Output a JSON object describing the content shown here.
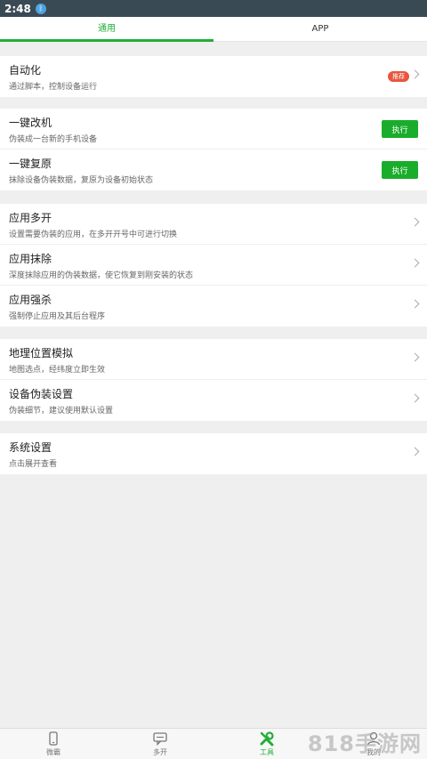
{
  "status": {
    "time": "2:48"
  },
  "tabs": [
    {
      "label": "通用"
    },
    {
      "label": "APP"
    }
  ],
  "rows": {
    "automation": {
      "title": "自动化",
      "sub": "通过脚本，控制设备运行",
      "badge": "推荐"
    },
    "one_key_modify": {
      "title": "一键改机",
      "sub": "伪装成一台新的手机设备",
      "action": "执行"
    },
    "one_key_restore": {
      "title": "一键复原",
      "sub": "抹除设备伪装数据，复原为设备初始状态",
      "action": "执行"
    },
    "app_multi": {
      "title": "应用多开",
      "sub": "设置需要伪装的应用，在多开开号中可进行切换"
    },
    "app_erase": {
      "title": "应用抹除",
      "sub": "深度抹除应用的伪装数据，使它恢复到刚安装的状态"
    },
    "app_kill": {
      "title": "应用强杀",
      "sub": "强制停止应用及其后台程序"
    },
    "geo_mock": {
      "title": "地理位置模拟",
      "sub": "地图选点，经纬度立即生效"
    },
    "device_spoof": {
      "title": "设备伪装设置",
      "sub": "伪装细节，建议使用默认设置"
    },
    "system_settings": {
      "title": "系统设置",
      "sub": "点击展开查看"
    }
  },
  "bottom_nav": [
    {
      "label": "微霸",
      "icon": "phone-icon"
    },
    {
      "label": "多开",
      "icon": "chat-icon"
    },
    {
      "label": "工具",
      "icon": "tools-icon"
    },
    {
      "label": "我的",
      "icon": "user-icon"
    }
  ],
  "watermark": "818手游网",
  "colors": {
    "accent": "#22ad38",
    "button": "#1aad2c",
    "badge": "#e8563e",
    "statusbar": "#3a4a55"
  }
}
